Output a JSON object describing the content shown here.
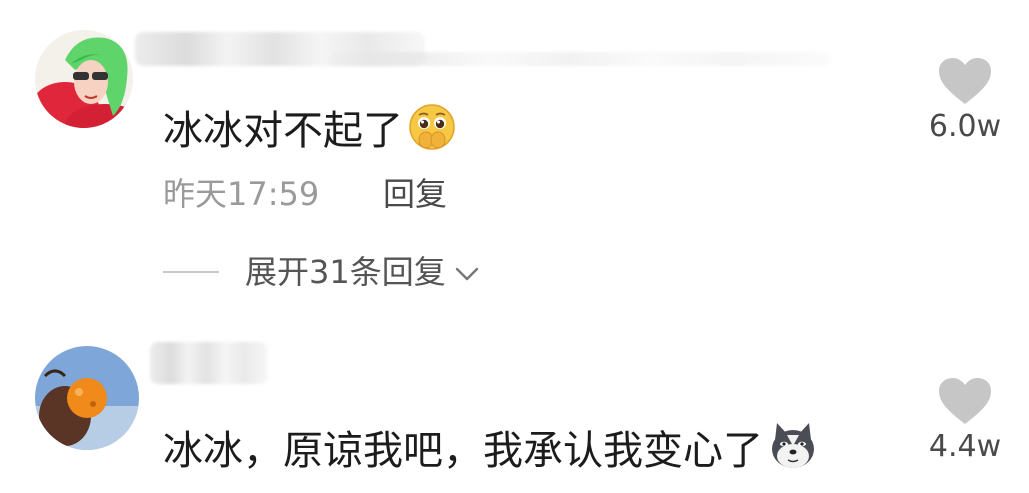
{
  "comments": [
    {
      "text": "冰冰对不起了",
      "emoji": "pleading-hands-face-emoji",
      "time": "昨天17:59",
      "reply_label": "回复",
      "likes": "6.0w",
      "expand_label": "展开31条回复"
    },
    {
      "text": "冰冰，原谅我吧，我承认我变心了",
      "emoji": "husky-dog-emoji",
      "likes": "4.4w"
    }
  ]
}
